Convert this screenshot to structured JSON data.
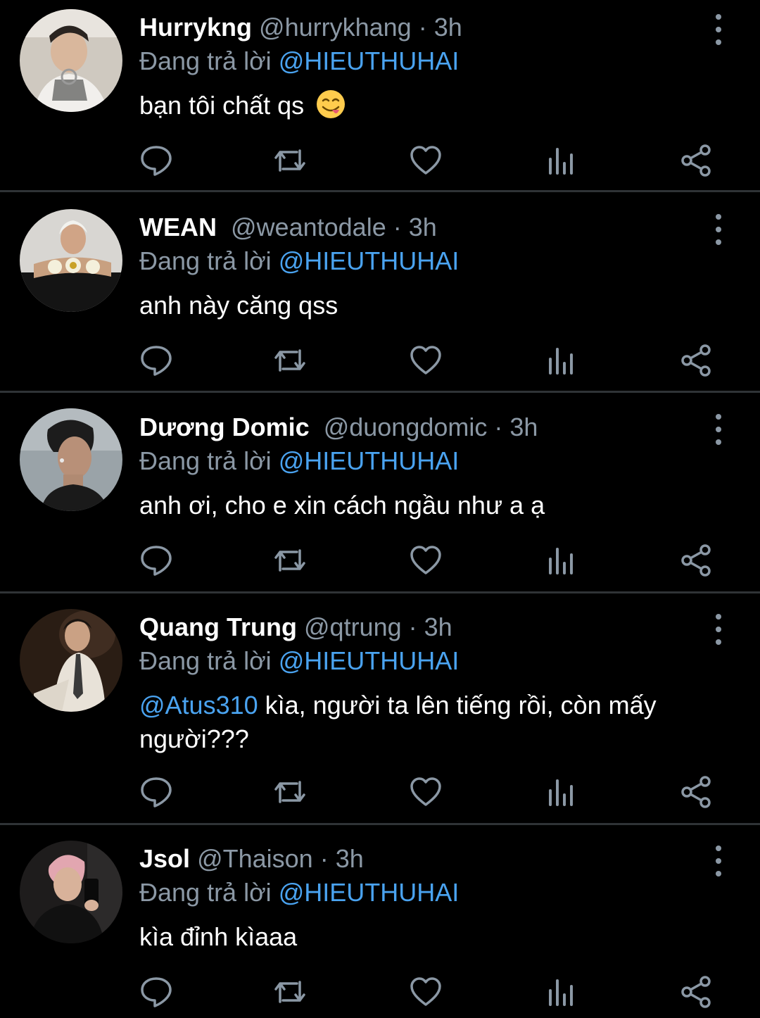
{
  "replying_prefix": "Đang trả lời",
  "replying_to": "@HIEUTHUHAI",
  "time_separator": "·",
  "replies": [
    {
      "display_name": "Hurrykng",
      "handle": "@hurrykhang",
      "time": "3h",
      "text": "bạn tôi chất qs",
      "emoji": "face-savoring-food"
    },
    {
      "display_name": "WEAN",
      "handle": "@weantodale",
      "time": "3h",
      "text": "anh này căng qss"
    },
    {
      "display_name": "Dương Domic",
      "handle": "@duongdomic",
      "time": "3h",
      "text": "anh ơi, cho e xin cách ngầu như a ạ"
    },
    {
      "display_name": "Quang Trung",
      "handle": "@qtrung",
      "time": "3h",
      "text_mention": "@Atus310",
      "text": " kìa, người ta lên tiếng rồi, còn mấy người???"
    },
    {
      "display_name": "Jsol",
      "handle": "@Thaison",
      "time": "3h",
      "text": "kìa đỉnh kìaaa"
    }
  ],
  "action_icons": [
    "reply-icon",
    "retweet-icon",
    "like-icon",
    "analytics-icon",
    "share-icon"
  ],
  "colors": {
    "background": "#000000",
    "separator": "#2f3336",
    "muted": "#8b98a5",
    "mention": "#4aa3f0",
    "text": "#ffffff"
  }
}
